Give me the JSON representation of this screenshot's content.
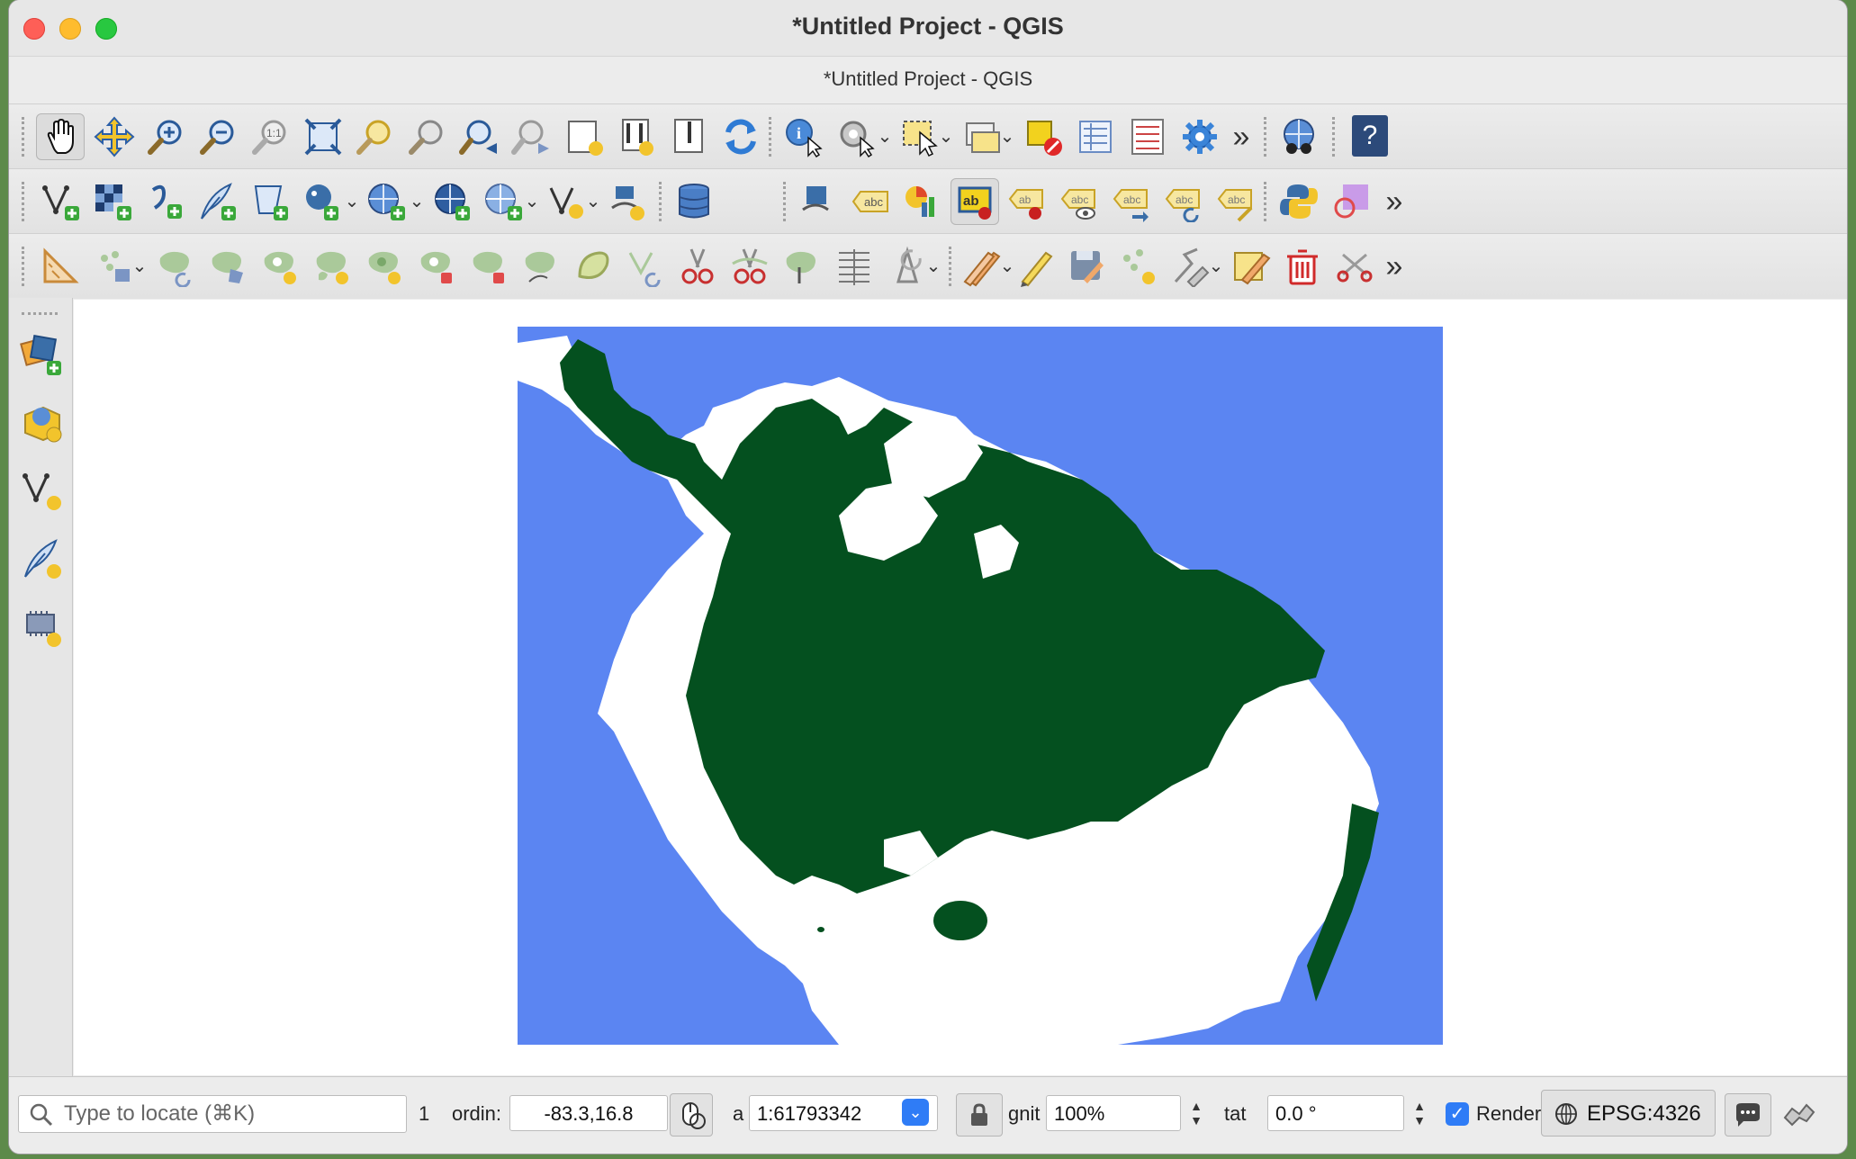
{
  "window": {
    "title": "*Untitled Project - QGIS",
    "subtitle": "*Untitled Project - QGIS"
  },
  "toolbars": {
    "row1_icons": [
      "pan-icon",
      "pan-to-selection-icon",
      "zoom-in-icon",
      "zoom-out-icon",
      "zoom-native-icon",
      "zoom-full-icon",
      "zoom-to-selection-icon",
      "zoom-to-layer-icon",
      "zoom-last-icon",
      "zoom-next-icon",
      "new-map-view-icon",
      "new-3d-map-view-icon",
      "temporal-controller-icon",
      "refresh-icon",
      "identify-icon",
      "run-action-icon",
      "select-features-icon",
      "open-attribute-table-icon",
      "deselect-icon",
      "open-field-calculator-icon",
      "statistical-summary-icon",
      "settings-icon",
      "more-tools-icon",
      "metasearch-icon",
      "help-icon"
    ],
    "row2_icons": [
      "add-vector-layer-icon",
      "add-raster-layer-icon",
      "add-delimited-text-icon",
      "add-spatialite-icon",
      "add-geopackage-icon",
      "add-postgis-icon",
      "add-wms-icon",
      "add-wfs-icon",
      "add-wcs-icon",
      "new-vector-layer-icon",
      "new-mesh-layer-icon",
      "db-manager-icon",
      "label-pin-icon",
      "label-abc-icon",
      "diagram-icon",
      "layer-labeling-icon",
      "pin-label-icon",
      "show-hide-label-icon",
      "move-label-icon",
      "rotate-label-icon",
      "change-label-icon",
      "python-console-icon",
      "overlay-icon",
      "more-tools-icon"
    ],
    "row3_icons": [
      "measure-icon",
      "move-feature-icon",
      "rotate-feature-icon",
      "simplify-icon",
      "add-ring-icon",
      "add-part-icon",
      "fill-ring-icon",
      "delete-ring-icon",
      "delete-part-icon",
      "reshape-icon",
      "offset-curve-icon",
      "reverse-line-icon",
      "split-features-icon",
      "split-parts-icon",
      "merge-features-icon",
      "merge-attributes-icon",
      "rotate-point-symbols-icon",
      "current-edits-icon",
      "toggle-editing-icon",
      "save-edits-icon",
      "add-point-icon",
      "vertex-tool-icon",
      "modify-attributes-icon",
      "delete-selected-icon",
      "cut-features-icon",
      "more-tools-icon"
    ]
  },
  "left_toolbar": [
    "open-data-source-manager-icon",
    "new-geopackage-layer-icon",
    "new-shapefile-layer-icon",
    "new-temporary-scratch-layer-icon",
    "new-virtual-layer-icon"
  ],
  "map": {
    "water_color": "#5b85f2",
    "forest_color": "#04501f",
    "land_color": "#ffffff"
  },
  "statusbar": {
    "search_placeholder": "Type to locate (⌘K)",
    "selected_count": "1",
    "coordinate_label": "ordin:",
    "coordinate_value": "-83.3,16.8",
    "scale_label": "a",
    "scale_value": "1:61793342",
    "magnifier_label": "gnit",
    "magnifier_value": "100%",
    "rotation_label": "tat",
    "rotation_value": "0.0 °",
    "render_label": "Render",
    "render_checked": true,
    "crs_value": "EPSG:4326"
  }
}
